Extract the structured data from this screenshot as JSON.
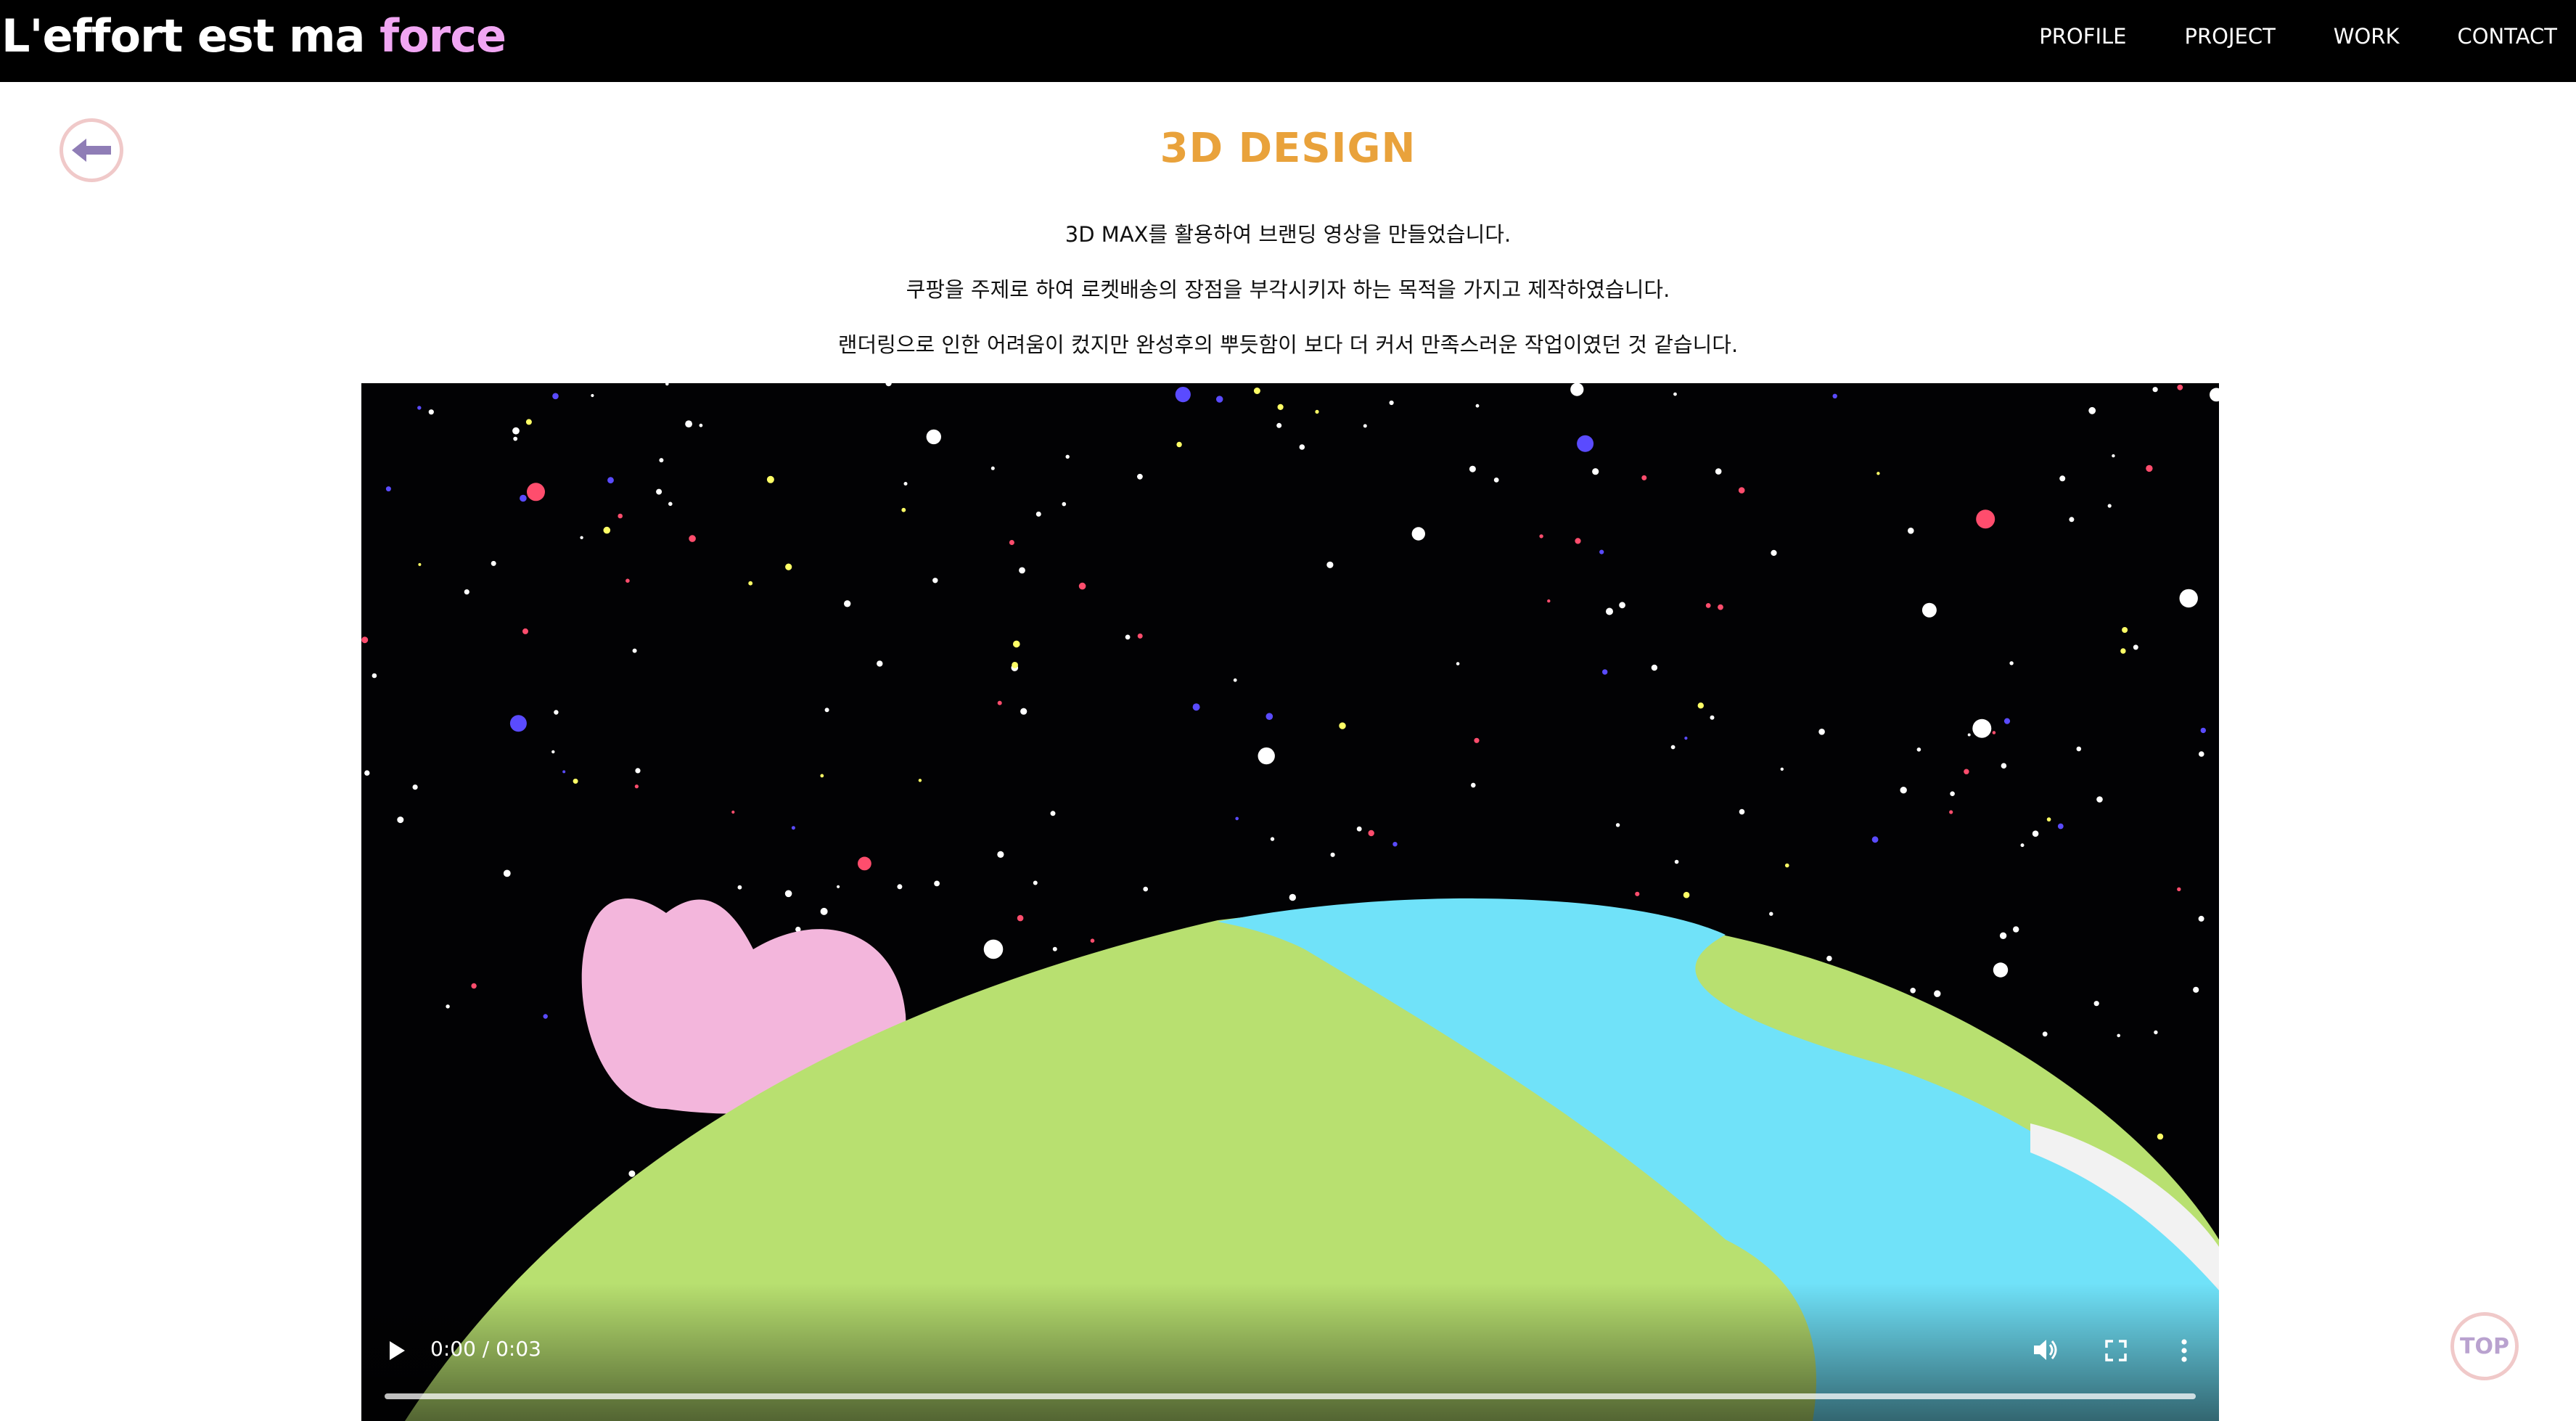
{
  "header": {
    "brand_main": "L'effort est ma",
    "brand_accent": "force",
    "brand_accent_color": "#f1a6f3",
    "nav": [
      "PROFILE",
      "PROJECT",
      "WORK",
      "CONTACT"
    ]
  },
  "back_button": {
    "icon": "arrow-left-icon"
  },
  "main": {
    "title": "3D DESIGN",
    "title_color": "#e9a23b",
    "descriptions": [
      "3D MAX를 활용하여 브랜딩 영상을 만들었습니다.",
      "쿠팡을 주제로 하여 로켓배송의 장점을 부각시키자 하는 목적을 가지고 제작하였습니다.",
      "랜더링으로 인한 어려움이 컸지만 완성후의 뿌듯함이 보다 더 커서 만족스러운 작업이였던 것 같습니다."
    ]
  },
  "video": {
    "time": "0:00 / 0:03",
    "play_icon": "play-icon",
    "volume_icon": "volume-icon",
    "fullscreen_icon": "fullscreen-icon",
    "more_icon": "more-vert-icon"
  },
  "top_button": {
    "label": "TOP"
  }
}
